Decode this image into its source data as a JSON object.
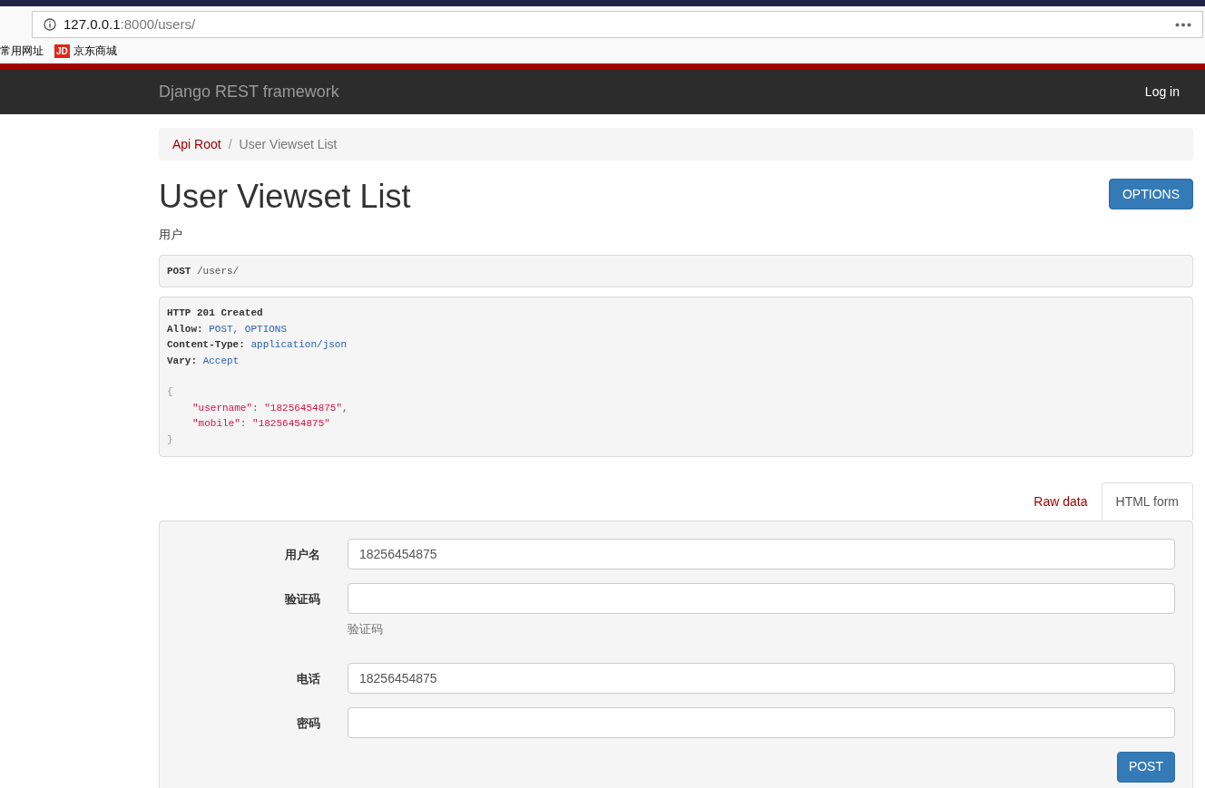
{
  "browser": {
    "url_host": "127.0.0.1",
    "url_rest": ":8000/users/",
    "bookmarks": [
      {
        "label": "常用网址",
        "kind": "plain"
      },
      {
        "label": "京东商城",
        "kind": "site",
        "icon_text": "JD"
      }
    ]
  },
  "navbar": {
    "brand": "Django REST framework",
    "login": "Log in"
  },
  "breadcrumbs": [
    {
      "label": "Api Root",
      "selected": false
    },
    {
      "separator": "/",
      "label": "User Viewset List",
      "selected": true
    }
  ],
  "page": {
    "title": "User Viewset List",
    "options_button": "OPTIONS",
    "description": "用户"
  },
  "request": {
    "method": "POST",
    "path": "/users/"
  },
  "response": {
    "status": "HTTP 201 Created",
    "headers": [
      {
        "name": "Allow:",
        "value": "POST, OPTIONS"
      },
      {
        "name": "Content-Type:",
        "value": "application/json"
      },
      {
        "name": "Vary:",
        "value": "Accept"
      }
    ],
    "open_brace": "{",
    "entries": [
      {
        "key": "\"username\"",
        "colon": ":",
        "value": "\"18256454875\"",
        "comma": ","
      },
      {
        "key": "\"mobile\"",
        "colon": ":",
        "value": "\"18256454875\""
      }
    ],
    "close_brace": "}"
  },
  "tabs": [
    {
      "label": "Raw data",
      "selected": false
    },
    {
      "label": "HTML form",
      "selected": true
    }
  ],
  "form": {
    "fields": [
      {
        "label": "用户名",
        "value": "18256454875"
      },
      {
        "label": "验证码",
        "help": "验证码"
      },
      {
        "label": "电话",
        "value": "18256454875"
      },
      {
        "label": "密码"
      }
    ],
    "submit": "POST"
  }
}
